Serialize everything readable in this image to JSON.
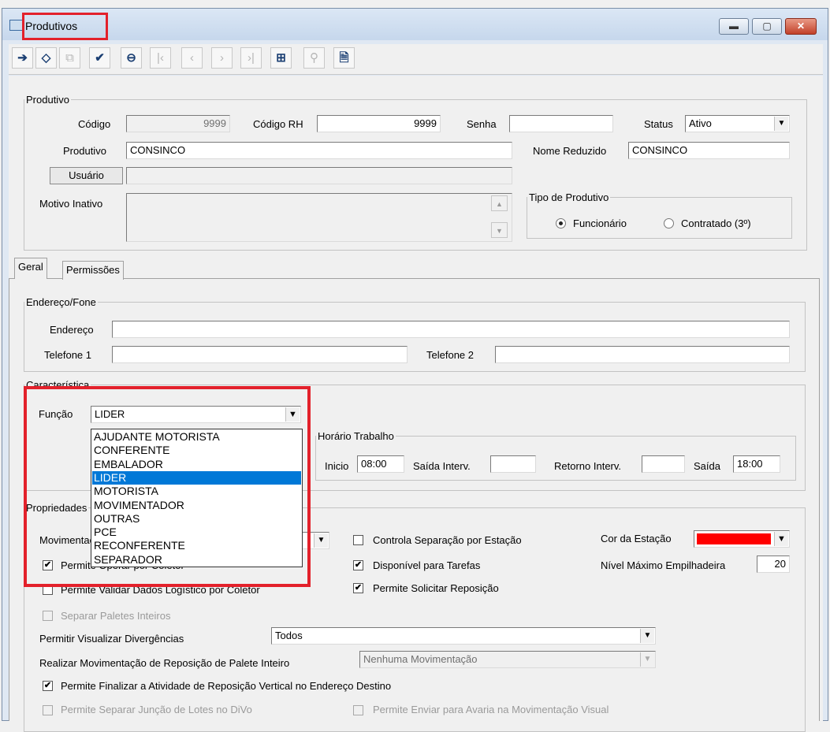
{
  "window": {
    "title": "Produtivos",
    "minimize_glyph": "▬",
    "maximize_glyph": "▢",
    "close_glyph": "✕"
  },
  "toolbar": {
    "buttons": [
      {
        "icon": "exit-icon",
        "glyph": "➔",
        "enabled": true
      },
      {
        "icon": "eraser-icon",
        "glyph": "◇",
        "enabled": true
      },
      {
        "icon": "copy-record-icon",
        "glyph": "⧉",
        "enabled": false
      },
      {
        "icon": "save-record-icon",
        "glyph": "✔",
        "enabled": true
      },
      {
        "icon": "delete-record-icon",
        "glyph": "⊖",
        "enabled": true
      },
      {
        "icon": "first-record-icon",
        "glyph": "|‹",
        "enabled": false
      },
      {
        "icon": "previous-record-icon",
        "glyph": "‹",
        "enabled": false
      },
      {
        "icon": "next-record-icon",
        "glyph": "›",
        "enabled": false
      },
      {
        "icon": "last-record-icon",
        "glyph": "›|",
        "enabled": false
      },
      {
        "icon": "grid-icon",
        "glyph": "⊞",
        "enabled": true
      },
      {
        "icon": "search-icon",
        "glyph": "⚲",
        "enabled": false
      },
      {
        "icon": "report-icon",
        "glyph": "🗎",
        "enabled": true
      }
    ]
  },
  "produtivo": {
    "legend": "Produtivo",
    "codigo_label": "Código",
    "codigo_value": "9999",
    "codigo_rh_label": "Código RH",
    "codigo_rh_value": "9999",
    "senha_label": "Senha",
    "senha_value": "",
    "status_label": "Status",
    "status_value": "Ativo",
    "produtivo_label": "Produtivo",
    "produtivo_value": "CONSINCO",
    "nome_reduzido_label": "Nome Reduzido",
    "nome_reduzido_value": "CONSINCO",
    "usuario_button": "Usuário",
    "usuario_value": "",
    "motivo_inativo_label": "Motivo Inativo",
    "motivo_inativo_value": "",
    "tipo_legend": "Tipo de Produtivo",
    "tipo_options": [
      "Funcionário",
      "Contratado (3º)"
    ],
    "tipo_selected": "Funcionário"
  },
  "tabs": [
    "Geral",
    "Permissões"
  ],
  "active_tab": "Geral",
  "endereco": {
    "legend": "Endereço/Fone",
    "endereco_label": "Endereço",
    "endereco_value": "",
    "telefone1_label": "Telefone 1",
    "telefone1_value": "",
    "telefone2_label": "Telefone 2",
    "telefone2_value": ""
  },
  "caracteristica": {
    "legend": "Característica",
    "funcao_label": "Função",
    "funcao_value": "LIDER",
    "funcao_options": [
      "AJUDANTE MOTORISTA",
      "CONFERENTE",
      "EMBALADOR",
      "LIDER",
      "MOTORISTA",
      "MOVIMENTADOR",
      "OUTRAS",
      "PCE",
      "RECONFERENTE",
      "SEPARADOR"
    ],
    "horario_legend": "Horário Trabalho",
    "inicio_label": "Inicio",
    "inicio_value": "08:00",
    "saida_interv_label": "Saída Interv.",
    "saida_interv_value": "",
    "retorno_interv_label": "Retorno Interv.",
    "retorno_interv_value": "",
    "saida_label": "Saída",
    "saida_value": "18:00"
  },
  "propriedades": {
    "legend": "Propriedades",
    "movimentacao_label": "Movimentação",
    "permite_coletor_label": "Permite Operar por Coletor",
    "permite_coletor_checked": true,
    "permite_validar_label": "Permite Validar Dados Logístico por Coletor",
    "permite_validar_checked": false,
    "controla_separacao_label": "Controla Separação por Estação",
    "controla_separacao_checked": false,
    "disponivel_tarefas_label": "Disponível para Tarefas",
    "disponivel_tarefas_checked": true,
    "permite_solicitar_label": "Permite Solicitar Reposição",
    "permite_solicitar_checked": true,
    "cor_estacao_label": "Cor da Estação",
    "cor_estacao_color": "#ff0000",
    "nivel_maximo_label": "Nível Máximo Empilhadeira",
    "nivel_maximo_value": "20",
    "separar_paletes_label": "Separar Paletes Inteiros",
    "separar_paletes_checked": false,
    "permitir_visualizar_label": "Permitir Visualizar Divergências",
    "permitir_visualizar_value": "Todos",
    "realizar_mov_label": "Realizar Movimentação de Reposição de Palete Inteiro",
    "realizar_mov_value": "Nenhuma Movimentação",
    "permite_finalizar_label": "Permite Finalizar a Atividade de Reposição Vertical no Endereço Destino",
    "permite_finalizar_checked": true,
    "permite_separar_juncao_label": "Permite Separar Junção de Lotes no DiVo",
    "permite_separar_juncao_checked": false,
    "permite_enviar_avaria_label": "Permite Enviar para Avaria na Movimentação Visual",
    "permite_enviar_avaria_checked": false
  },
  "colors": {
    "highlight": "#e3212b",
    "selection": "#0078d7"
  },
  "check_glyph": "✔",
  "dropdown_glyph": "▼",
  "scroll_up_glyph": "▲",
  "scroll_down_glyph": "▼"
}
